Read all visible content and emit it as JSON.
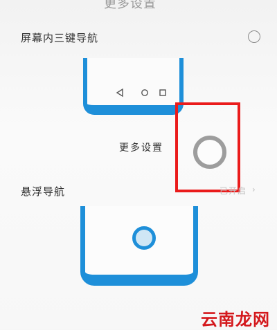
{
  "header": {
    "clipped_title": "更多设置"
  },
  "options": {
    "three_key_nav": {
      "label": "屏幕内三键导航",
      "selected": false
    },
    "floating_nav": {
      "label": "悬浮导航",
      "status": "已开启",
      "chevron": "›"
    }
  },
  "three_key_nav_preview": {
    "keys": [
      "back-icon",
      "home-icon",
      "recents-icon"
    ]
  },
  "more_settings": {
    "label": "更多设置"
  },
  "floating_button": {
    "icon": "floating-nav-ring-icon"
  },
  "watermark": {
    "text": "云南龙网"
  },
  "colors": {
    "accent_blue": "#1e8fd9",
    "highlight_red": "#ea1b1b",
    "ring_gray": "#9d9d9d",
    "watermark_red": "#d4181c"
  }
}
